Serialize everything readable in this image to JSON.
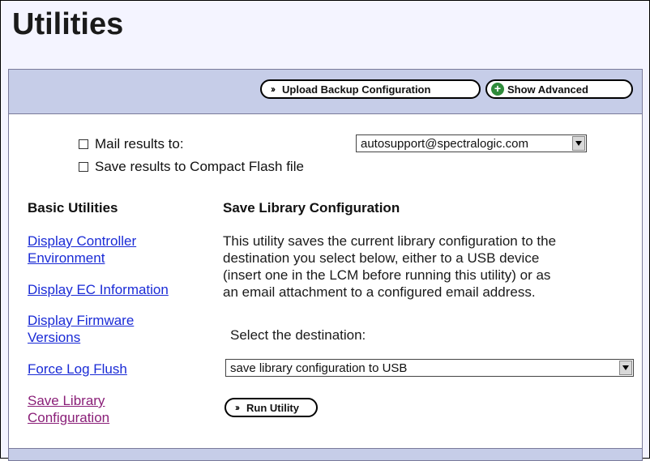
{
  "page": {
    "title": "Utilities"
  },
  "toolbar": {
    "upload_label": "Upload Backup Configuration",
    "advanced_label": "Show Advanced"
  },
  "options": {
    "mail_label": "Mail results to:",
    "mail_value": "autosupport@spectralogic.com",
    "mail_checked": false,
    "flash_label": "Save results to Compact Flash file",
    "flash_checked": false
  },
  "sidebar": {
    "heading": "Basic Utilities",
    "items": [
      {
        "lines": [
          "Display Controller",
          "Environment"
        ]
      },
      {
        "lines": [
          "Display EC Information"
        ]
      },
      {
        "lines": [
          "Display Firmware",
          "Versions"
        ]
      },
      {
        "lines": [
          "Force Log Flush"
        ]
      },
      {
        "lines": [
          "Save Library",
          "Configuration"
        ],
        "visited": true
      }
    ]
  },
  "main": {
    "heading": "Save Library Configuration",
    "description": [
      "This utility saves the current library configuration to the",
      "destination you select below, either to a USB device",
      "(insert one in the LCM before running this utility) or as",
      "an email attachment to a configured email address."
    ],
    "destination_label": "Select the destination:",
    "destination_value": "save library configuration to USB",
    "run_label": "Run Utility"
  },
  "icons": {
    "arrows": "double-chevron-right-icon",
    "plus": "plus-circle-icon",
    "dropdown": "chevron-down-icon"
  }
}
